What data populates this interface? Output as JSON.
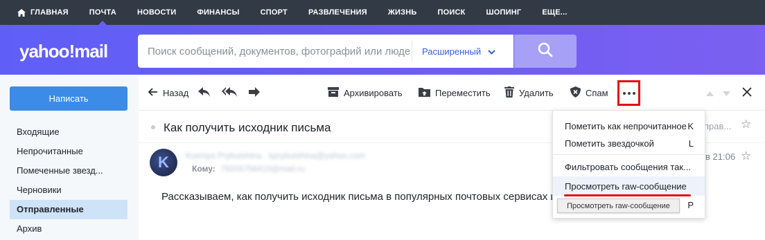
{
  "topnav": {
    "items": [
      {
        "label": "ГЛАВНАЯ",
        "icon": "home-icon"
      },
      {
        "label": "ПОЧТА",
        "active": true
      },
      {
        "label": "НОВОСТИ"
      },
      {
        "label": "ФИНАНСЫ"
      },
      {
        "label": "СПОРТ"
      },
      {
        "label": "РАЗВЛЕЧЕНИЯ"
      },
      {
        "label": "ЖИЗНЬ"
      },
      {
        "label": "ПОИСК"
      },
      {
        "label": "ШОПИНГ"
      },
      {
        "label": "ЕЩЕ..."
      }
    ]
  },
  "header": {
    "logo": "yahoo!mail",
    "search_placeholder": "Поиск сообщений, документов, фотографий или людей",
    "advanced_label": "Расширенный",
    "search_icon": "search-icon"
  },
  "sidebar": {
    "compose_label": "Написать",
    "folders": [
      {
        "label": "Входящие"
      },
      {
        "label": "Непрочитанные"
      },
      {
        "label": "Помеченные звезд..."
      },
      {
        "label": "Черновики"
      },
      {
        "label": "Отправленные",
        "active": true
      },
      {
        "label": "Архив"
      }
    ]
  },
  "toolbar": {
    "back_label": "Назад",
    "archive_label": "Архивировать",
    "move_label": "Переместить",
    "delete_label": "Удалить",
    "spam_label": "Спам"
  },
  "message": {
    "subject": "Как получить исходник письма",
    "subject_right": "прав...",
    "sender": "Kseniya Prybutshina · kprybutshina@yahoo.com",
    "to_label": "Кому:",
    "to_value": "79205756410@mail.ru",
    "time": "в 21:06",
    "avatar_letter": "K",
    "body": "Рассказываем, как получить исходник письма в популярных почтовых сервисах и п"
  },
  "menu": {
    "items": [
      {
        "label": "Пометить как непрочитанное",
        "key": "K"
      },
      {
        "label": "Пометить звездочкой",
        "key": "L"
      },
      {
        "label": "Фильтровать сообщения так...",
        "key": ""
      },
      {
        "label": "Просмотреть raw-сообщение",
        "key": ""
      },
      {
        "label": "",
        "key": "P"
      }
    ],
    "tooltip": "Просмотреть raw-сообщение"
  },
  "colors": {
    "nav_bg": "#323a45",
    "brand_purple": "#6a5cf4",
    "compose_blue": "#3c8be6",
    "highlight_red": "#e20a0a"
  }
}
